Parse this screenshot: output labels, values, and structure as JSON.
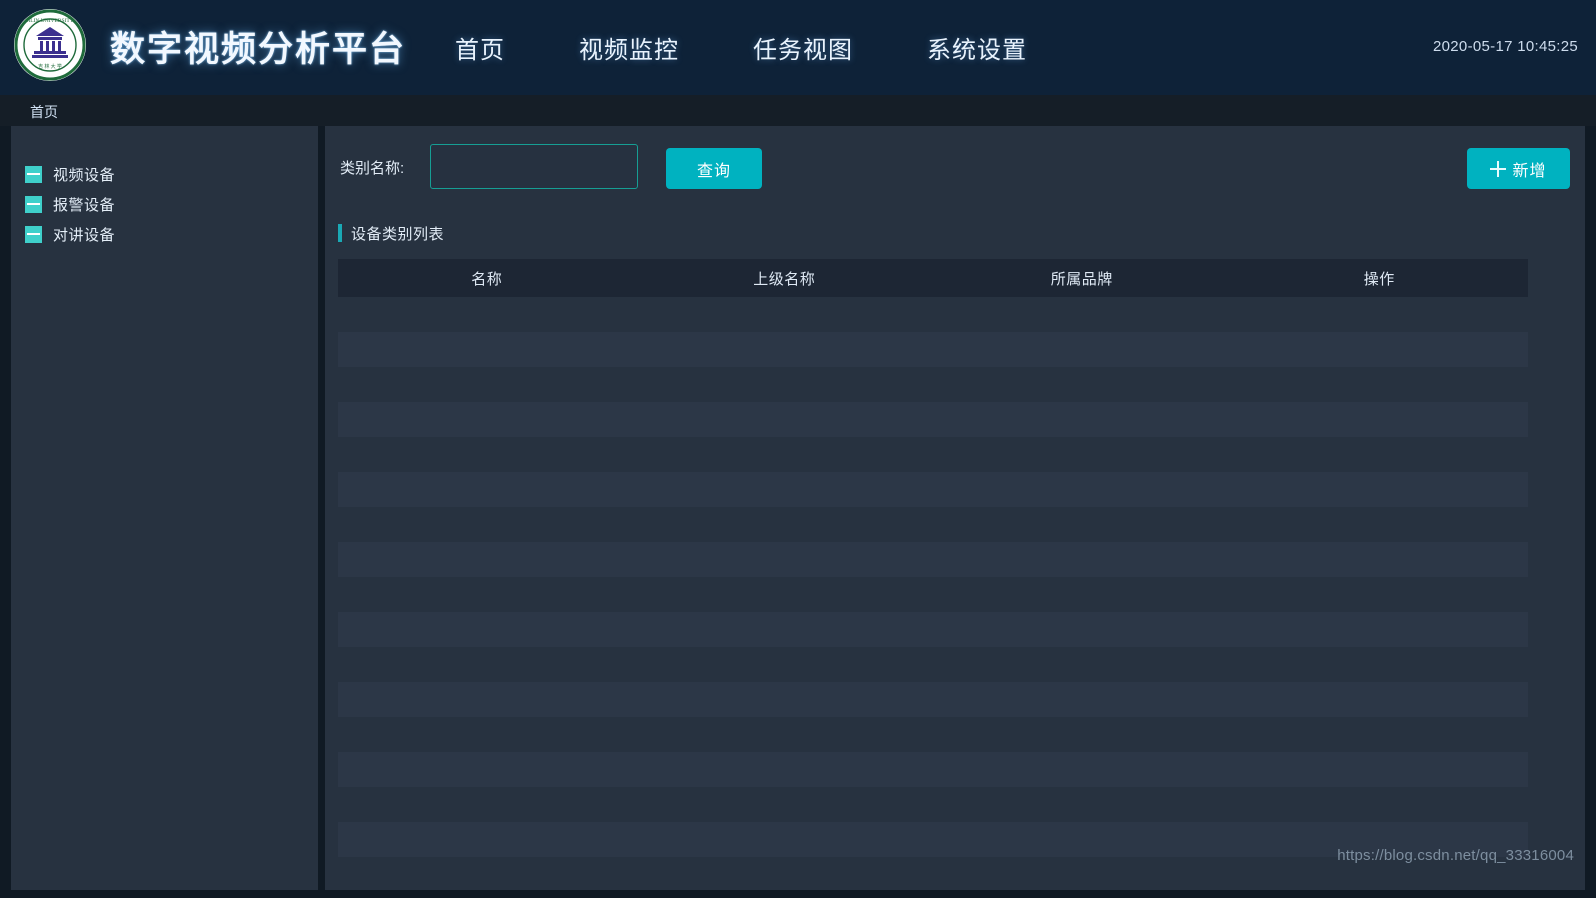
{
  "header": {
    "logo_alt": "university-emblem",
    "title": "数字视频分析平台",
    "nav": [
      {
        "label": "首页"
      },
      {
        "label": "视频监控"
      },
      {
        "label": "任务视图"
      },
      {
        "label": "系统设置"
      }
    ],
    "clock": "2020-05-17 10:45:25"
  },
  "breadcrumb": {
    "current": "首页"
  },
  "sidebar": {
    "items": [
      {
        "label": "视频设备",
        "icon": "list-square-icon"
      },
      {
        "label": "报警设备",
        "icon": "list-square-icon"
      },
      {
        "label": "对讲设备",
        "icon": "list-square-icon"
      }
    ]
  },
  "toolbar": {
    "filter_label": "类别名称:",
    "filter_value": "",
    "filter_placeholder": "",
    "search_label": "查询",
    "add_label": "新增",
    "add_icon": "plus-icon"
  },
  "section": {
    "title": "设备类别列表"
  },
  "table": {
    "columns": [
      "名称",
      "上级名称",
      "所属品牌",
      "操作"
    ],
    "rows": [],
    "empty_row_count": 16
  },
  "watermark": {
    "text": "https://blog.csdn.net/qq_33316004"
  },
  "colors": {
    "header_bg": "#0e2238",
    "breadcrumb_bg": "#151e27",
    "panel_bg": "#273240",
    "page_bg": "#101a24",
    "accent_teal": "#00b2c0",
    "icon_teal": "#3fd0cb",
    "table_head_bg": "#1d2634",
    "row_alt_bg": "#2c3747",
    "text_primary": "#e4eef8"
  }
}
